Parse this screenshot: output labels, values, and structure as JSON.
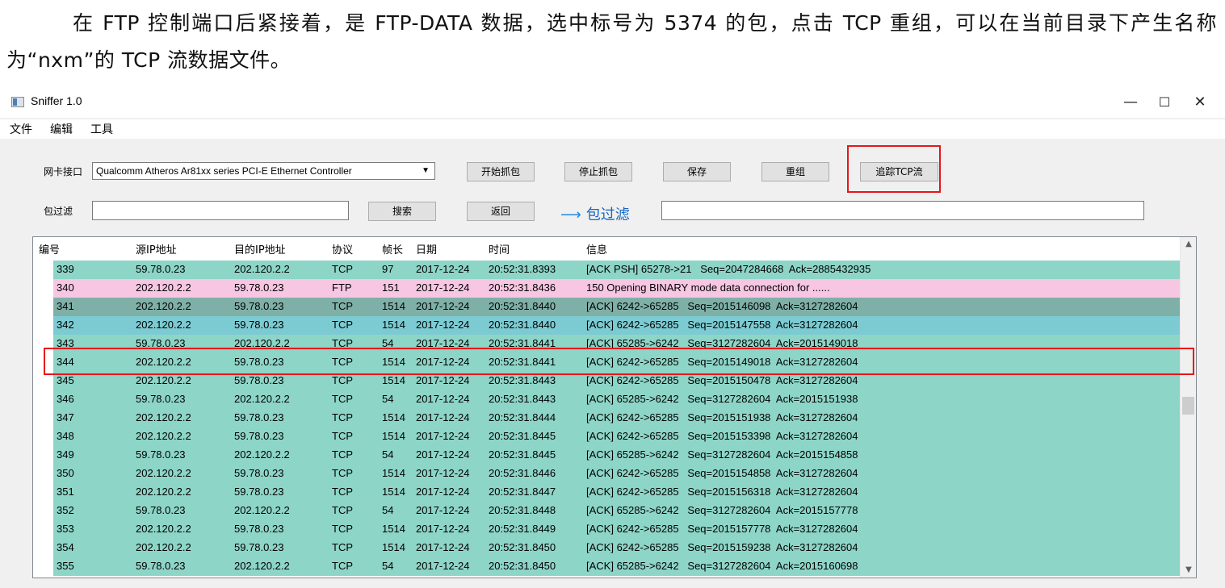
{
  "doc": {
    "paragraph": "在 FTP 控制端口后紧接着，是 FTP-DATA 数据，选中标号为 5374 的包，点击 TCP 重组，可以在当前目录下产生名称为“nxm”的 TCP 流数据文件。"
  },
  "window": {
    "title": "Sniffer 1.0",
    "minimize": "—",
    "maximize": "☐",
    "close": "✕"
  },
  "menu": [
    "文件",
    "编辑",
    "工具"
  ],
  "toolbar": {
    "nic_label": "网卡接口",
    "nic_value": "Qualcomm Atheros Ar81xx series PCI-E Ethernet Controller",
    "start_label": "开始抓包",
    "stop_label": "停止抓包",
    "save_label": "保存",
    "reassemble_label": "重组",
    "follow_tcp_label": "追踪TCP流",
    "filter_label": "包过滤",
    "filter_value": "",
    "search_label": "搜索",
    "back_label": "返回",
    "filter_hint": "包过滤",
    "filter_hint_value": ""
  },
  "table": {
    "headers": [
      "编号",
      "源IP地址",
      "目的IP地址",
      "协议",
      "帧长",
      "日期",
      "时间",
      "信息"
    ],
    "selected_row": 2,
    "colors": {
      "tcp": "#8dd5c7",
      "ftp": "#f7c6e3",
      "selected": "#7fb0a8",
      "after_selected": "#7ccbd2"
    },
    "rows": [
      [
        "339",
        "59.78.0.23",
        "202.120.2.2",
        "TCP",
        "97",
        "2017-12-24",
        "20:52:31.8393",
        "[ACK PSH] 65278->21   Seq=2047284668  Ack=2885432935"
      ],
      [
        "340",
        "202.120.2.2",
        "59.78.0.23",
        "FTP",
        "151",
        "2017-12-24",
        "20:52:31.8436",
        "150 Opening BINARY mode data connection for ......"
      ],
      [
        "341",
        "202.120.2.2",
        "59.78.0.23",
        "TCP",
        "1514",
        "2017-12-24",
        "20:52:31.8440",
        "[ACK] 6242->65285   Seq=2015146098  Ack=3127282604"
      ],
      [
        "342",
        "202.120.2.2",
        "59.78.0.23",
        "TCP",
        "1514",
        "2017-12-24",
        "20:52:31.8440",
        "[ACK] 6242->65285   Seq=2015147558  Ack=3127282604"
      ],
      [
        "343",
        "59.78.0.23",
        "202.120.2.2",
        "TCP",
        "54",
        "2017-12-24",
        "20:52:31.8441",
        "[ACK] 65285->6242   Seq=3127282604  Ack=2015149018"
      ],
      [
        "344",
        "202.120.2.2",
        "59.78.0.23",
        "TCP",
        "1514",
        "2017-12-24",
        "20:52:31.8441",
        "[ACK] 6242->65285   Seq=2015149018  Ack=3127282604"
      ],
      [
        "345",
        "202.120.2.2",
        "59.78.0.23",
        "TCP",
        "1514",
        "2017-12-24",
        "20:52:31.8443",
        "[ACK] 6242->65285   Seq=2015150478  Ack=3127282604"
      ],
      [
        "346",
        "59.78.0.23",
        "202.120.2.2",
        "TCP",
        "54",
        "2017-12-24",
        "20:52:31.8443",
        "[ACK] 65285->6242   Seq=3127282604  Ack=2015151938"
      ],
      [
        "347",
        "202.120.2.2",
        "59.78.0.23",
        "TCP",
        "1514",
        "2017-12-24",
        "20:52:31.8444",
        "[ACK] 6242->65285   Seq=2015151938  Ack=3127282604"
      ],
      [
        "348",
        "202.120.2.2",
        "59.78.0.23",
        "TCP",
        "1514",
        "2017-12-24",
        "20:52:31.8445",
        "[ACK] 6242->65285   Seq=2015153398  Ack=3127282604"
      ],
      [
        "349",
        "59.78.0.23",
        "202.120.2.2",
        "TCP",
        "54",
        "2017-12-24",
        "20:52:31.8445",
        "[ACK] 65285->6242   Seq=3127282604  Ack=2015154858"
      ],
      [
        "350",
        "202.120.2.2",
        "59.78.0.23",
        "TCP",
        "1514",
        "2017-12-24",
        "20:52:31.8446",
        "[ACK] 6242->65285   Seq=2015154858  Ack=3127282604"
      ],
      [
        "351",
        "202.120.2.2",
        "59.78.0.23",
        "TCP",
        "1514",
        "2017-12-24",
        "20:52:31.8447",
        "[ACK] 6242->65285   Seq=2015156318  Ack=3127282604"
      ],
      [
        "352",
        "59.78.0.23",
        "202.120.2.2",
        "TCP",
        "54",
        "2017-12-24",
        "20:52:31.8448",
        "[ACK] 65285->6242   Seq=3127282604  Ack=2015157778"
      ],
      [
        "353",
        "202.120.2.2",
        "59.78.0.23",
        "TCP",
        "1514",
        "2017-12-24",
        "20:52:31.8449",
        "[ACK] 6242->65285   Seq=2015157778  Ack=3127282604"
      ],
      [
        "354",
        "202.120.2.2",
        "59.78.0.23",
        "TCP",
        "1514",
        "2017-12-24",
        "20:52:31.8450",
        "[ACK] 6242->65285   Seq=2015159238  Ack=3127282604"
      ],
      [
        "355",
        "59.78.0.23",
        "202.120.2.2",
        "TCP",
        "54",
        "2017-12-24",
        "20:52:31.8450",
        "[ACK] 65285->6242   Seq=3127282604  Ack=2015160698"
      ]
    ]
  }
}
